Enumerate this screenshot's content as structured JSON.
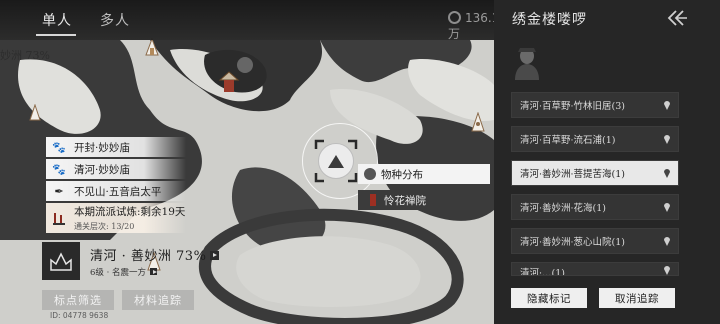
{
  "tabs": [
    {
      "label": "单人",
      "active": true
    },
    {
      "label": "多人",
      "active": false
    }
  ],
  "currency": {
    "value": "136.1万"
  },
  "map_region_label": "妙洲 73%",
  "quests": [
    {
      "icon": "paw-icon",
      "label": "开封·妙妙庙"
    },
    {
      "icon": "paw-icon",
      "label": "清河·妙妙庙"
    },
    {
      "icon": "quill-icon",
      "label": "不见山·五音启太平"
    },
    {
      "icon": "flag-pair-icon",
      "label": "本期流派试炼:剩余19天",
      "sub": "通关层次: 13/20"
    }
  ],
  "location": {
    "name": "清河 · 善妙洲 73%",
    "sub": "6级 · 名震一方",
    "filter_button": "标点筛选",
    "material_button": "材料追踪",
    "player_id": "ID: 04778 9638"
  },
  "popover": {
    "species_label": "物种分布",
    "temple_label": "怜花禅院"
  },
  "side_panel": {
    "title": "绣金楼喽啰",
    "locations": [
      {
        "label": "清河·百草野·竹林旧居(3)",
        "active": false
      },
      {
        "label": "清河·百草野·流石浦(1)",
        "active": false
      },
      {
        "label": "清河·善妙洲·菩提苦海(1)",
        "active": true
      },
      {
        "label": "清河·善妙洲·花海(1)",
        "active": false
      },
      {
        "label": "清河·善妙洲·葱心山院(1)",
        "active": false
      },
      {
        "label": "清河·…(1)",
        "active": false
      }
    ],
    "hide_button": "隐藏标记",
    "cancel_button": "取消追踪"
  },
  "colors": {
    "panel_bg": "#262626",
    "map_bg": "#cfcfcb",
    "accent_red": "#9e2f22"
  }
}
